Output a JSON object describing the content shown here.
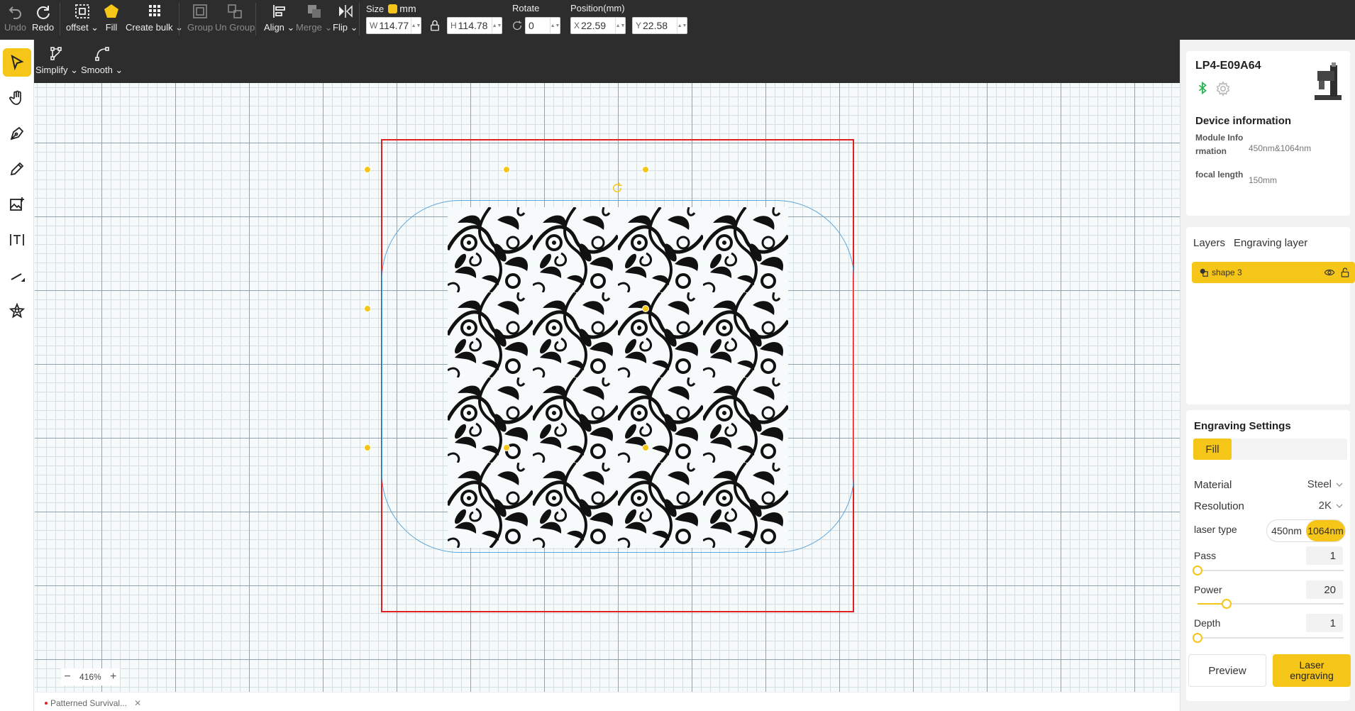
{
  "toolbar": {
    "undo": "Undo",
    "redo": "Redo",
    "offset": "offset",
    "fill": "Fill",
    "create_bulk": "Create bulk",
    "group": "Group",
    "ungroup": "Un Group",
    "align": "Align",
    "merge": "Merge",
    "flip": "Flip",
    "size_label": "Size",
    "unit": "mm",
    "width_prefix": "W",
    "width": "114.77",
    "height_prefix": "H",
    "height": "114.78",
    "rotate_label": "Rotate",
    "rotate": "0",
    "position_label": "Position(mm)",
    "x_prefix": "X",
    "x": "22.59",
    "y_prefix": "Y",
    "y": "22.58"
  },
  "subtoolbar": {
    "simplify": "Simplify",
    "smooth": "Smooth"
  },
  "left_tools": [
    "select-tool-icon",
    "hand-tool-icon",
    "pen-tool-icon",
    "pencil-tool-icon",
    "image-tool-icon",
    "text-tool-icon",
    "line-tool-icon",
    "shape-tool-icon"
  ],
  "canvas": {
    "zoom": "416%"
  },
  "file_tab": {
    "name": "Patterned Survival..."
  },
  "device": {
    "name": "LP4-E09A64",
    "info_title": "Device information",
    "module_label": "Module Information",
    "module_value": "450nm&1064nm",
    "focal_label": "focal length",
    "focal_value": "150mm"
  },
  "layers": {
    "tab_layers": "Layers",
    "tab_engraving": "Engraving layer",
    "items": [
      {
        "name": "shape 3"
      }
    ]
  },
  "settings": {
    "title": "Engraving Settings",
    "mode": "Fill",
    "material_label": "Material",
    "material": "Steel",
    "resolution_label": "Resolution",
    "resolution": "2K",
    "laser_label": "laser type",
    "laser_options": [
      "450nm",
      "1064nm"
    ],
    "laser_selected": "1064nm",
    "pass_label": "Pass",
    "pass": 1,
    "pass_level": 0,
    "power_label": "Power",
    "power": 20,
    "power_level": 0.2,
    "depth_label": "Depth",
    "depth": 1,
    "depth_level": 0
  },
  "actions": {
    "preview": "Preview",
    "engrave": "Laser engraving"
  },
  "colors": {
    "accent": "#f5c518",
    "toolbar_bg": "#2d2d2d",
    "work_area_border": "#e02020",
    "selection_border": "#5aa6dc"
  }
}
